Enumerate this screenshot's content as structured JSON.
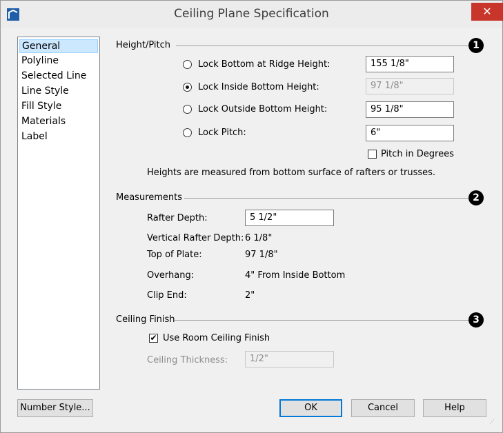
{
  "window": {
    "title": "Ceiling Plane Specification",
    "close_glyph": "✕",
    "app_icon": "chief-architect-logo"
  },
  "sidebar": {
    "items": [
      {
        "label": "General",
        "selected": true
      },
      {
        "label": "Polyline"
      },
      {
        "label": "Selected Line"
      },
      {
        "label": "Line Style"
      },
      {
        "label": "Fill Style"
      },
      {
        "label": "Materials"
      },
      {
        "label": "Label"
      }
    ]
  },
  "height_pitch": {
    "section_label": "Height/Pitch",
    "badge": "1",
    "options": [
      {
        "label": "Lock Bottom at Ridge Height:",
        "value": "155 1/8\"",
        "selected": false,
        "disabled": false
      },
      {
        "label": "Lock Inside Bottom Height:",
        "value": "97 1/8\"",
        "selected": true,
        "disabled": true
      },
      {
        "label": "Lock Outside Bottom Height:",
        "value": "95 1/8\"",
        "selected": false,
        "disabled": false
      },
      {
        "label": "Lock Pitch:",
        "value": "6\"",
        "selected": false,
        "disabled": false
      }
    ],
    "pitch_in_degrees_label": "Pitch in Degrees",
    "pitch_in_degrees_checked": false,
    "note": "Heights are measured from bottom surface of rafters or trusses."
  },
  "measurements": {
    "section_label": "Measurements",
    "badge": "2",
    "rafter_depth_label": "Rafter Depth:",
    "rafter_depth_value": "5 1/2\"",
    "vertical_rafter_depth_label": "Vertical Rafter Depth:",
    "vertical_rafter_depth_value": "6 1/8\"",
    "top_of_plate_label": "Top of Plate:",
    "top_of_plate_value": "97 1/8\"",
    "overhang_label": "Overhang:",
    "overhang_value": "4\"  From Inside Bottom",
    "clip_end_label": "Clip End:",
    "clip_end_value": "2\""
  },
  "ceiling_finish": {
    "section_label": "Ceiling Finish",
    "badge": "3",
    "use_room_label": "Use Room Ceiling Finish",
    "use_room_checked": true,
    "check_glyph": "✔",
    "thickness_label": "Ceiling Thickness:",
    "thickness_value": "1/2\""
  },
  "buttons": {
    "number_style": "Number Style...",
    "ok": "OK",
    "cancel": "Cancel",
    "help": "Help"
  },
  "colors": {
    "accent": "#0078d7",
    "close": "#c7352b",
    "selection": "#cce8ff"
  }
}
